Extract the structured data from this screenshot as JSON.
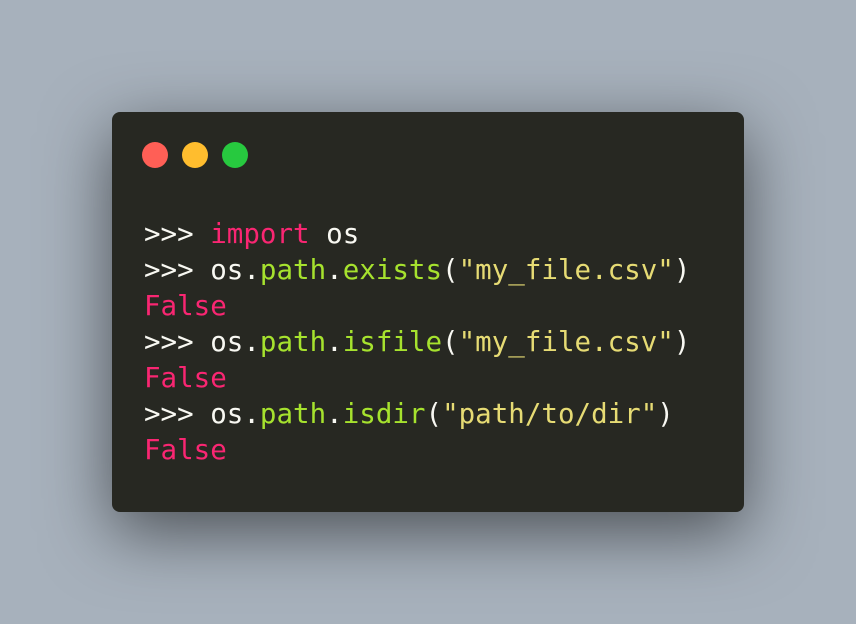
{
  "window": {
    "buttons": {
      "close_color": "#ff5f56",
      "minimize_color": "#ffbd2e",
      "maximize_color": "#27c93f"
    }
  },
  "colors": {
    "plain": "#f8f8f2",
    "keyword": "#f92672",
    "attribute": "#a6e22e",
    "string": "#e6db74"
  },
  "code": {
    "prompt": ">>> ",
    "lines": [
      {
        "tokens": [
          {
            "t": "prompt"
          },
          {
            "t": "keyword",
            "v": "import"
          },
          {
            "t": "plain",
            "v": " os"
          }
        ]
      },
      {
        "tokens": [
          {
            "t": "prompt"
          },
          {
            "t": "plain",
            "v": "os."
          },
          {
            "t": "attribute",
            "v": "path"
          },
          {
            "t": "plain",
            "v": "."
          },
          {
            "t": "attribute",
            "v": "exists"
          },
          {
            "t": "plain",
            "v": "("
          },
          {
            "t": "string",
            "v": "\"my_file.csv\""
          },
          {
            "t": "plain",
            "v": ")"
          }
        ]
      },
      {
        "tokens": [
          {
            "t": "keyword",
            "v": "False"
          }
        ]
      },
      {
        "tokens": [
          {
            "t": "prompt"
          },
          {
            "t": "plain",
            "v": "os."
          },
          {
            "t": "attribute",
            "v": "path"
          },
          {
            "t": "plain",
            "v": "."
          },
          {
            "t": "attribute",
            "v": "isfile"
          },
          {
            "t": "plain",
            "v": "("
          },
          {
            "t": "string",
            "v": "\"my_file.csv\""
          },
          {
            "t": "plain",
            "v": ")"
          }
        ]
      },
      {
        "tokens": [
          {
            "t": "keyword",
            "v": "False"
          }
        ]
      },
      {
        "tokens": [
          {
            "t": "prompt"
          },
          {
            "t": "plain",
            "v": "os."
          },
          {
            "t": "attribute",
            "v": "path"
          },
          {
            "t": "plain",
            "v": "."
          },
          {
            "t": "attribute",
            "v": "isdir"
          },
          {
            "t": "plain",
            "v": "("
          },
          {
            "t": "string",
            "v": "\"path/to/dir\""
          },
          {
            "t": "plain",
            "v": ")"
          }
        ]
      },
      {
        "tokens": [
          {
            "t": "keyword",
            "v": "False"
          }
        ]
      }
    ]
  }
}
